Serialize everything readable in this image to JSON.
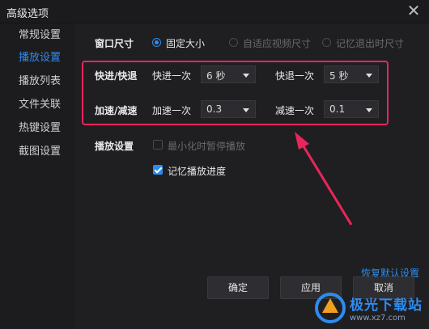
{
  "window": {
    "title": "高级选项",
    "close_glyph": "✕"
  },
  "sidebar": {
    "items": [
      {
        "label": "常规设置"
      },
      {
        "label": "播放设置",
        "active": true
      },
      {
        "label": "播放列表"
      },
      {
        "label": "文件关联"
      },
      {
        "label": "热键设置"
      },
      {
        "label": "截图设置"
      }
    ]
  },
  "window_size": {
    "label": "窗口尺寸",
    "options": [
      {
        "label": "固定大小",
        "selected": true
      },
      {
        "label": "自适应视频尺寸",
        "selected": false
      },
      {
        "label": "记忆退出时尺寸",
        "selected": false
      }
    ]
  },
  "seek": {
    "label": "快进/快退",
    "forward_label": "快进一次",
    "forward_value": "6 秒",
    "backward_label": "快退一次",
    "backward_value": "5 秒"
  },
  "speed": {
    "label": "加速/减速",
    "up_label": "加速一次",
    "up_value": "0.3",
    "down_label": "减速一次",
    "down_value": "0.1"
  },
  "playback": {
    "label": "播放设置",
    "pause_minimized": {
      "label": "最小化时暂停播放",
      "checked": false
    },
    "remember_progress": {
      "label": "记忆播放进度",
      "checked": true
    }
  },
  "restore_defaults": "恢复默认设置",
  "buttons": {
    "ok": "确定",
    "apply": "应用",
    "cancel": "取消"
  },
  "watermark": {
    "text": "极光下载站",
    "url": "www.xz7.com"
  },
  "colors": {
    "accent": "#2d8cf0",
    "annotation": "#e8265a",
    "background": "#1f1f22"
  }
}
